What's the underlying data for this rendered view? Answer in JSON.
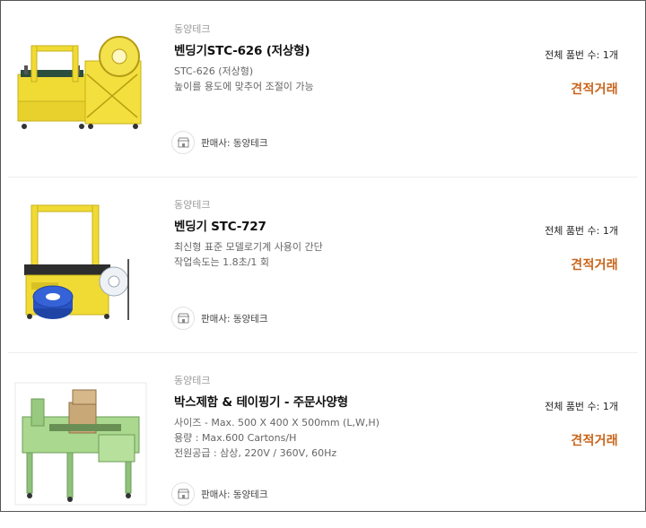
{
  "products": [
    {
      "brand": "동양테크",
      "title": "벤딩기STC-626 (저상형)",
      "desc": [
        "STC-626 (저상형)",
        "높이를 용도에 맞추어 조절이 가능"
      ],
      "seller_label": "판매사: 동양테크",
      "count_label": "전체 품번 수: 1개",
      "action_label": "견적거래",
      "image": "yellow-low-strapping-machine"
    },
    {
      "brand": "동양테크",
      "title": "벤딩기 STC-727",
      "desc": [
        "최신형 표준 모델로기계 사용이 간단",
        "작업속도는 1.8초/1 회"
      ],
      "seller_label": "판매사: 동양테크",
      "count_label": "전체 품번 수: 1개",
      "action_label": "견적거래",
      "image": "yellow-strapping-machine-with-blue-reel"
    },
    {
      "brand": "동양테크",
      "title": "박스제함 & 테이핑기 - 주문사양형",
      "desc": [
        "사이즈 - Max. 500 X 400 X 500mm (L,W,H)",
        "용량 : Max.600 Cartons/H",
        "전원공급 : 삼상, 220V / 360V, 60Hz"
      ],
      "seller_label": "판매사: 동양테크",
      "count_label": "전체 품번 수: 1개",
      "action_label": "견적거래",
      "image": "green-box-erector-taping-machine"
    }
  ],
  "colors": {
    "accent": "#c9641a",
    "yellow": "#f2de3a",
    "green": "#a9d88e"
  }
}
